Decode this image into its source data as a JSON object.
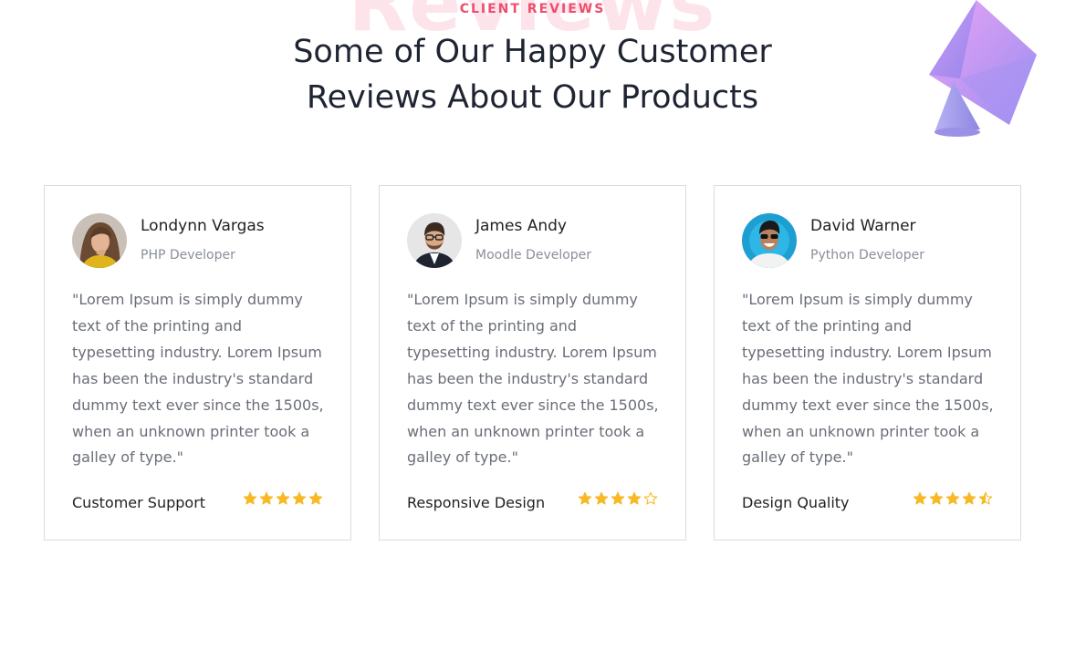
{
  "hero": {
    "background_word": "Reviews",
    "eyebrow": "CLIENT REVIEWS",
    "headline_line1": "Some of Our Happy Customer",
    "headline_line2": "Reviews About Our Products"
  },
  "colors": {
    "accent": "#ef4d6d",
    "background_word": "#fde3ea",
    "star": "#f7b924",
    "card_border": "#dcdcdc",
    "heading": "#1f2433",
    "body_text": "#6a6e78"
  },
  "reviews": [
    {
      "name": "Londynn Vargas",
      "role": "PHP Developer",
      "quote": "\"Lorem Ipsum is simply dummy text of the printing and typesetting industry. Lorem Ipsum has been the industry's standard dummy text ever since the 1500s, when an unknown printer took a galley of type.\"",
      "category": "Customer Support",
      "rating": 5,
      "avatar_icon": "woman-portrait-avatar"
    },
    {
      "name": "James Andy",
      "role": "Moodle Developer",
      "quote": "\"Lorem Ipsum is simply dummy text of the printing and typesetting industry. Lorem Ipsum has been the industry's standard dummy text ever since the 1500s, when an unknown printer took a galley of type.\"",
      "category": "Responsive Design",
      "rating": 4,
      "avatar_icon": "man-glasses-portrait-avatar"
    },
    {
      "name": "David Warner",
      "role": "Python Developer",
      "quote": "\"Lorem Ipsum is simply dummy text of the printing and typesetting industry. Lorem Ipsum has been the industry's standard dummy text ever since the 1500s, when an unknown printer took a galley of type.\"",
      "category": "Design Quality",
      "rating": 4.5,
      "avatar_icon": "man-sunglasses-portrait-avatar"
    }
  ]
}
